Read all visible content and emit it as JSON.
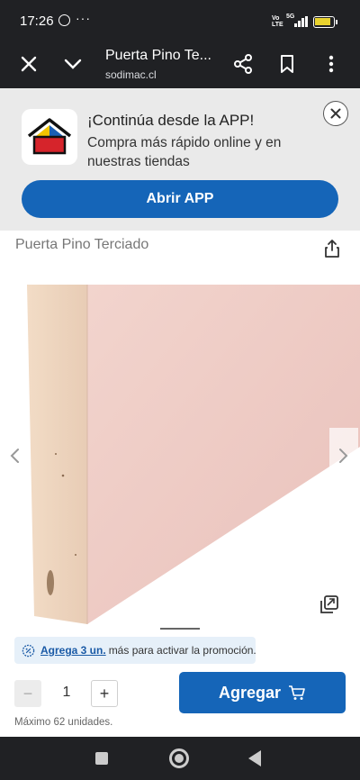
{
  "status_bar": {
    "time": "17:26",
    "notification_icons": [
      "whatsapp-icon"
    ],
    "more": "···",
    "network": {
      "volte_line1": "Vo",
      "volte_line2": "LTE",
      "generation": "5G"
    },
    "battery_color": "#e8d22e"
  },
  "browser": {
    "page_title": "Puerta Pino Te...",
    "domain": "sodimac.cl",
    "actions": [
      "close-icon",
      "chevron-down-icon",
      "share-icon",
      "bookmark-icon",
      "more-vert-icon"
    ]
  },
  "app_banner": {
    "heading": "¡Continúa desde la APP!",
    "text": "Compra más rápido online y en nuestras tiendas",
    "button_label": "Abrir APP",
    "button_color": "#1565b8"
  },
  "product": {
    "title": "Puerta Pino Terciado",
    "image_description_icon": "plywood-door-image"
  },
  "promotion": {
    "link_text": "Agrega 3 un.",
    "text": "más para activar la promoción."
  },
  "quantity": {
    "minus": "−",
    "value": "1",
    "plus": "+",
    "max_note": "Máximo 62 unidades."
  },
  "add_to_cart": {
    "label": "Agregar"
  },
  "colors": {
    "brand_blue": "#1565b8",
    "dark_bar": "#202124"
  }
}
